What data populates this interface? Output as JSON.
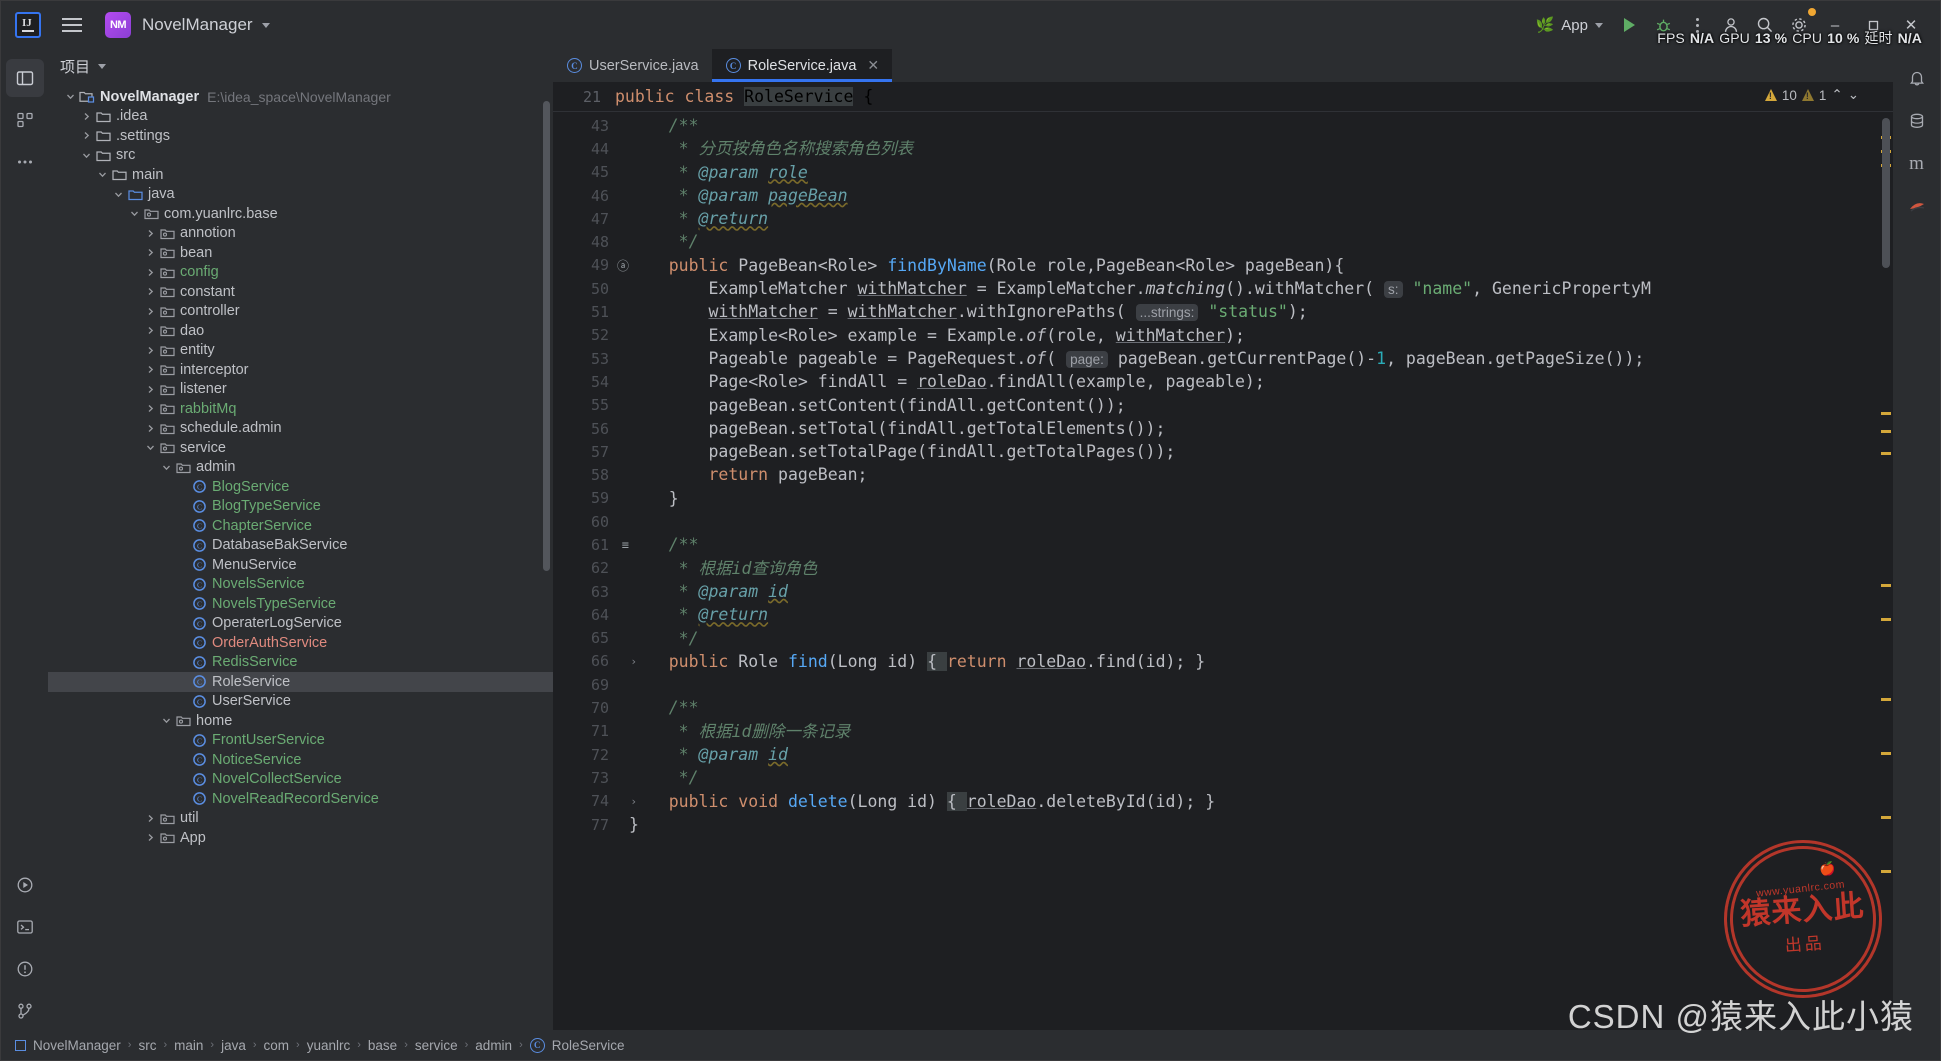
{
  "titlebar": {
    "logo_label": "IJ",
    "project_badge": "NM",
    "project_name": "NovelManager",
    "run_config": "App",
    "icons": [
      "leaf-icon",
      "run-icon",
      "debug-icon",
      "more-icon",
      "account-icon",
      "search-icon",
      "settings-icon"
    ],
    "window_controls": {
      "minimize": "–",
      "maximize": "❐",
      "close": "✕"
    },
    "perf": {
      "fps_label": "FPS",
      "fps_value": "N/A",
      "gpu_label": "GPU",
      "gpu_value": "13 %",
      "cpu_label": "CPU",
      "cpu_value": "10 %",
      "lat_label": "延时",
      "lat_value": "N/A"
    }
  },
  "left_rail": [
    {
      "name": "project-tool-icon",
      "glyph": "▣"
    },
    {
      "name": "structure-tool-icon",
      "glyph": "⌸"
    },
    {
      "name": "more-tools-icon",
      "glyph": "⋯"
    },
    {
      "name": "run-tool-icon",
      "glyph": "▷"
    },
    {
      "name": "terminal-tool-icon",
      "glyph": "⌨"
    },
    {
      "name": "problems-tool-icon",
      "glyph": "ⓘ"
    },
    {
      "name": "vcs-tool-icon",
      "glyph": "⎇"
    }
  ],
  "right_rail": [
    {
      "name": "notifications-icon",
      "glyph": "ὑ4"
    },
    {
      "name": "database-icon",
      "glyph": "⌸"
    },
    {
      "name": "maven-icon",
      "glyph": "m"
    },
    {
      "name": "ai-assistant-icon",
      "glyph": "◕"
    }
  ],
  "project_panel": {
    "header": "项目",
    "tree": [
      {
        "depth": 0,
        "twist": "v",
        "icon": "module-icon",
        "label": "NovelManager",
        "path": "E:\\idea_space\\NovelManager",
        "style": "bold"
      },
      {
        "depth": 1,
        "twist": ">",
        "icon": "folder-icon",
        "label": ".idea",
        "style": "white"
      },
      {
        "depth": 1,
        "twist": ">",
        "icon": "folder-icon",
        "label": ".settings",
        "style": "white"
      },
      {
        "depth": 1,
        "twist": "v",
        "icon": "folder-icon",
        "label": "src",
        "style": "white"
      },
      {
        "depth": 2,
        "twist": "v",
        "icon": "folder-icon",
        "label": "main",
        "style": "white"
      },
      {
        "depth": 3,
        "twist": "v",
        "icon": "source-root-icon",
        "label": "java",
        "style": "white"
      },
      {
        "depth": 4,
        "twist": "v",
        "icon": "package-icon",
        "label": "com.yuanlrc.base",
        "style": "white"
      },
      {
        "depth": 5,
        "twist": ">",
        "icon": "package-icon",
        "label": "annotion",
        "style": "white"
      },
      {
        "depth": 5,
        "twist": ">",
        "icon": "package-icon",
        "label": "bean",
        "style": "white"
      },
      {
        "depth": 5,
        "twist": ">",
        "icon": "package-icon",
        "label": "config",
        "style": "green"
      },
      {
        "depth": 5,
        "twist": ">",
        "icon": "package-icon",
        "label": "constant",
        "style": "white"
      },
      {
        "depth": 5,
        "twist": ">",
        "icon": "package-icon",
        "label": "controller",
        "style": "white"
      },
      {
        "depth": 5,
        "twist": ">",
        "icon": "package-icon",
        "label": "dao",
        "style": "white"
      },
      {
        "depth": 5,
        "twist": ">",
        "icon": "package-icon",
        "label": "entity",
        "style": "white"
      },
      {
        "depth": 5,
        "twist": ">",
        "icon": "package-icon",
        "label": "interceptor",
        "style": "white"
      },
      {
        "depth": 5,
        "twist": ">",
        "icon": "package-icon",
        "label": "listener",
        "style": "white"
      },
      {
        "depth": 5,
        "twist": ">",
        "icon": "package-icon",
        "label": "rabbitMq",
        "style": "green"
      },
      {
        "depth": 5,
        "twist": ">",
        "icon": "package-icon",
        "label": "schedule.admin",
        "style": "white"
      },
      {
        "depth": 5,
        "twist": "v",
        "icon": "package-icon",
        "label": "service",
        "style": "white"
      },
      {
        "depth": 6,
        "twist": "v",
        "icon": "package-icon",
        "label": "admin",
        "style": "white"
      },
      {
        "depth": 7,
        "twist": "",
        "icon": "class-icon",
        "label": "BlogService",
        "style": "green"
      },
      {
        "depth": 7,
        "twist": "",
        "icon": "class-icon",
        "label": "BlogTypeService",
        "style": "green"
      },
      {
        "depth": 7,
        "twist": "",
        "icon": "class-icon",
        "label": "ChapterService",
        "style": "green"
      },
      {
        "depth": 7,
        "twist": "",
        "icon": "class-icon",
        "label": "DatabaseBakService",
        "style": "white"
      },
      {
        "depth": 7,
        "twist": "",
        "icon": "class-icon",
        "label": "MenuService",
        "style": "white"
      },
      {
        "depth": 7,
        "twist": "",
        "icon": "class-icon",
        "label": "NovelsService",
        "style": "green"
      },
      {
        "depth": 7,
        "twist": "",
        "icon": "class-icon",
        "label": "NovelsTypeService",
        "style": "green"
      },
      {
        "depth": 7,
        "twist": "",
        "icon": "class-icon",
        "label": "OperaterLogService",
        "style": "white"
      },
      {
        "depth": 7,
        "twist": "",
        "icon": "class-icon",
        "label": "OrderAuthService",
        "style": "red"
      },
      {
        "depth": 7,
        "twist": "",
        "icon": "class-icon",
        "label": "RedisService",
        "style": "green"
      },
      {
        "depth": 7,
        "twist": "",
        "icon": "class-icon",
        "label": "RoleService",
        "style": "white",
        "selected": true
      },
      {
        "depth": 7,
        "twist": "",
        "icon": "class-icon",
        "label": "UserService",
        "style": "white"
      },
      {
        "depth": 6,
        "twist": "v",
        "icon": "package-icon",
        "label": "home",
        "style": "white"
      },
      {
        "depth": 7,
        "twist": "",
        "icon": "class-icon",
        "label": "FrontUserService",
        "style": "green"
      },
      {
        "depth": 7,
        "twist": "",
        "icon": "class-icon",
        "label": "NoticeService",
        "style": "green"
      },
      {
        "depth": 7,
        "twist": "",
        "icon": "class-icon",
        "label": "NovelCollectService",
        "style": "green"
      },
      {
        "depth": 7,
        "twist": "",
        "icon": "class-icon",
        "label": "NovelReadRecordService",
        "style": "green"
      },
      {
        "depth": 5,
        "twist": ">",
        "icon": "package-icon",
        "label": "util",
        "style": "white"
      },
      {
        "depth": 5,
        "twist": ">",
        "icon": "package-icon",
        "label": "App",
        "style": "white"
      }
    ]
  },
  "editor": {
    "tabs": [
      {
        "label": "UserService.java",
        "active": false,
        "closable": false
      },
      {
        "label": "RoleService.java",
        "active": true,
        "closable": true,
        "close_glyph": "✕"
      }
    ],
    "sticky_line_number": "21",
    "sticky_segments": [
      {
        "t": "public class ",
        "c": "kw"
      },
      {
        "t": "RoleService",
        "c": "hl-ident"
      },
      {
        "t": " {",
        "c": ""
      }
    ],
    "inspections": {
      "warnings_major": "10",
      "warnings_minor": "1",
      "up_glyph": "⌃",
      "down_glyph": "⌄"
    },
    "lines": [
      {
        "n": "43",
        "mark": "",
        "fold": "",
        "segs": [
          {
            "t": "    ",
            "c": ""
          },
          {
            "t": "/**",
            "c": "cm"
          }
        ]
      },
      {
        "n": "44",
        "mark": "",
        "fold": "",
        "segs": [
          {
            "t": "     ",
            "c": ""
          },
          {
            "t": "* 分页按角色名称搜索角色列表",
            "c": "cm"
          }
        ]
      },
      {
        "n": "45",
        "mark": "",
        "fold": "",
        "segs": [
          {
            "t": "     ",
            "c": ""
          },
          {
            "t": "* ",
            "c": "cm"
          },
          {
            "t": "@param",
            "c": "tag2"
          },
          {
            "t": " ",
            "c": ""
          },
          {
            "t": "role",
            "c": "tag"
          }
        ]
      },
      {
        "n": "46",
        "mark": "",
        "fold": "",
        "segs": [
          {
            "t": "     ",
            "c": ""
          },
          {
            "t": "* ",
            "c": "cm"
          },
          {
            "t": "@param",
            "c": "tag2"
          },
          {
            "t": " ",
            "c": ""
          },
          {
            "t": "pageBean",
            "c": "tag"
          }
        ]
      },
      {
        "n": "47",
        "mark": "",
        "fold": "",
        "segs": [
          {
            "t": "     ",
            "c": ""
          },
          {
            "t": "* ",
            "c": "cm"
          },
          {
            "t": "@return",
            "c": "tag"
          }
        ]
      },
      {
        "n": "48",
        "mark": "",
        "fold": "",
        "segs": [
          {
            "t": "     ",
            "c": ""
          },
          {
            "t": "*/",
            "c": "cm"
          }
        ]
      },
      {
        "n": "49",
        "mark": "@",
        "fold": "",
        "segs": [
          {
            "t": "    ",
            "c": ""
          },
          {
            "t": "public ",
            "c": "kw"
          },
          {
            "t": "PageBean<Role> ",
            "c": ""
          },
          {
            "t": "findByName",
            "c": "fn"
          },
          {
            "t": "(Role role,PageBean<Role> pageBean){",
            "c": ""
          }
        ]
      },
      {
        "n": "50",
        "mark": "",
        "fold": "",
        "segs": [
          {
            "t": "        ExampleMatcher ",
            "c": ""
          },
          {
            "t": "withMatcher",
            "c": "fld"
          },
          {
            "t": " = ExampleMatcher.",
            "c": ""
          },
          {
            "t": "matching",
            "c": "ital"
          },
          {
            "t": "().withMatcher( ",
            "c": ""
          },
          {
            "t": "s:",
            "c": "hint"
          },
          {
            "t": " ",
            "c": ""
          },
          {
            "t": "\"name\"",
            "c": "str"
          },
          {
            "t": ", GenericPropertyM",
            "c": ""
          }
        ]
      },
      {
        "n": "51",
        "mark": "",
        "fold": "",
        "segs": [
          {
            "t": "        ",
            "c": ""
          },
          {
            "t": "withMatcher",
            "c": "fld"
          },
          {
            "t": " = ",
            "c": ""
          },
          {
            "t": "withMatcher",
            "c": "fld"
          },
          {
            "t": ".withIgnorePaths( ",
            "c": ""
          },
          {
            "t": "...strings:",
            "c": "hint"
          },
          {
            "t": " ",
            "c": ""
          },
          {
            "t": "\"status\"",
            "c": "str"
          },
          {
            "t": ");",
            "c": ""
          }
        ]
      },
      {
        "n": "52",
        "mark": "",
        "fold": "",
        "segs": [
          {
            "t": "        Example<Role> example = Example.",
            "c": ""
          },
          {
            "t": "of",
            "c": "ital"
          },
          {
            "t": "(role, ",
            "c": ""
          },
          {
            "t": "withMatcher",
            "c": "fld"
          },
          {
            "t": ");",
            "c": ""
          }
        ]
      },
      {
        "n": "53",
        "mark": "",
        "fold": "",
        "segs": [
          {
            "t": "        Pageable pageable = PageRequest.",
            "c": ""
          },
          {
            "t": "of",
            "c": "ital"
          },
          {
            "t": "( ",
            "c": ""
          },
          {
            "t": "page:",
            "c": "hint"
          },
          {
            "t": " pageBean.getCurrentPage()-",
            "c": ""
          },
          {
            "t": "1",
            "c": "num"
          },
          {
            "t": ", pageBean.getPageSize());",
            "c": ""
          }
        ]
      },
      {
        "n": "54",
        "mark": "",
        "fold": "",
        "segs": [
          {
            "t": "        Page<Role> findAll = ",
            "c": ""
          },
          {
            "t": "roleDao",
            "c": "fld"
          },
          {
            "t": ".findAll(example, pageable);",
            "c": ""
          }
        ]
      },
      {
        "n": "55",
        "mark": "",
        "fold": "",
        "segs": [
          {
            "t": "        pageBean.setContent(findAll.getContent());",
            "c": ""
          }
        ]
      },
      {
        "n": "56",
        "mark": "",
        "fold": "",
        "segs": [
          {
            "t": "        pageBean.setTotal(findAll.getTotalElements());",
            "c": ""
          }
        ]
      },
      {
        "n": "57",
        "mark": "",
        "fold": "",
        "segs": [
          {
            "t": "        pageBean.setTotalPage(findAll.getTotalPages());",
            "c": ""
          }
        ]
      },
      {
        "n": "58",
        "mark": "",
        "fold": "",
        "segs": [
          {
            "t": "        ",
            "c": ""
          },
          {
            "t": "return",
            "c": "kw"
          },
          {
            "t": " pageBean;",
            "c": ""
          }
        ]
      },
      {
        "n": "59",
        "mark": "",
        "fold": "",
        "segs": [
          {
            "t": "    }",
            "c": ""
          }
        ]
      },
      {
        "n": "60",
        "mark": "",
        "fold": "",
        "segs": [
          {
            "t": "",
            "c": ""
          }
        ]
      },
      {
        "n": "61",
        "mark": "≡",
        "fold": "",
        "segs": [
          {
            "t": "    ",
            "c": ""
          },
          {
            "t": "/**",
            "c": "cm"
          }
        ]
      },
      {
        "n": "62",
        "mark": "",
        "fold": "",
        "segs": [
          {
            "t": "     ",
            "c": ""
          },
          {
            "t": "* 根据id查询角色",
            "c": "cm"
          }
        ]
      },
      {
        "n": "63",
        "mark": "",
        "fold": "",
        "segs": [
          {
            "t": "     ",
            "c": ""
          },
          {
            "t": "* ",
            "c": "cm"
          },
          {
            "t": "@param",
            "c": "tag2"
          },
          {
            "t": " ",
            "c": ""
          },
          {
            "t": "id",
            "c": "tag"
          }
        ]
      },
      {
        "n": "64",
        "mark": "",
        "fold": "",
        "segs": [
          {
            "t": "     ",
            "c": ""
          },
          {
            "t": "* ",
            "c": "cm"
          },
          {
            "t": "@return",
            "c": "tag"
          }
        ]
      },
      {
        "n": "65",
        "mark": "",
        "fold": "",
        "segs": [
          {
            "t": "     ",
            "c": ""
          },
          {
            "t": "*/",
            "c": "cm"
          }
        ]
      },
      {
        "n": "66",
        "mark": "",
        "fold": ">",
        "segs": [
          {
            "t": "    ",
            "c": ""
          },
          {
            "t": "public ",
            "c": "kw"
          },
          {
            "t": "Role ",
            "c": ""
          },
          {
            "t": "find",
            "c": "fn"
          },
          {
            "t": "(Long id) ",
            "c": ""
          },
          {
            "t": "{ ",
            "c": "hl-ident"
          },
          {
            "t": "return",
            "c": "kw"
          },
          {
            "t": " ",
            "c": ""
          },
          {
            "t": "roleDao",
            "c": "fld"
          },
          {
            "t": ".find(id); }",
            "c": ""
          }
        ]
      },
      {
        "n": "69",
        "mark": "",
        "fold": "",
        "segs": [
          {
            "t": "",
            "c": ""
          }
        ]
      },
      {
        "n": "70",
        "mark": "",
        "fold": "",
        "segs": [
          {
            "t": "    ",
            "c": ""
          },
          {
            "t": "/**",
            "c": "cm"
          }
        ]
      },
      {
        "n": "71",
        "mark": "",
        "fold": "",
        "segs": [
          {
            "t": "     ",
            "c": ""
          },
          {
            "t": "* 根据id删除一条记录",
            "c": "cm"
          }
        ]
      },
      {
        "n": "72",
        "mark": "",
        "fold": "",
        "segs": [
          {
            "t": "     ",
            "c": ""
          },
          {
            "t": "* ",
            "c": "cm"
          },
          {
            "t": "@param",
            "c": "tag2"
          },
          {
            "t": " ",
            "c": ""
          },
          {
            "t": "id",
            "c": "tag"
          }
        ]
      },
      {
        "n": "73",
        "mark": "",
        "fold": "",
        "segs": [
          {
            "t": "     ",
            "c": ""
          },
          {
            "t": "*/",
            "c": "cm"
          }
        ]
      },
      {
        "n": "74",
        "mark": "",
        "fold": ">",
        "segs": [
          {
            "t": "    ",
            "c": ""
          },
          {
            "t": "public void ",
            "c": "kw"
          },
          {
            "t": "delete",
            "c": "fn"
          },
          {
            "t": "(Long id) ",
            "c": ""
          },
          {
            "t": "{ ",
            "c": "hl-ident"
          },
          {
            "t": "roleDao",
            "c": "fld"
          },
          {
            "t": ".deleteById(id); }",
            "c": ""
          }
        ]
      },
      {
        "n": "77",
        "mark": "",
        "fold": "",
        "segs": [
          {
            "t": "}",
            "c": ""
          }
        ]
      }
    ]
  },
  "status_bar": {
    "breadcrumb": [
      "NovelManager",
      "src",
      "main",
      "java",
      "com",
      "yuanlrc",
      "base",
      "service",
      "admin",
      "RoleService"
    ],
    "separator": "›"
  },
  "watermarks": {
    "stamp_domain": "www.yuanlrc.com",
    "stamp_main": "猿来入此",
    "stamp_sub": "出品",
    "csdn_text": "CSDN @猿来入此小猿"
  },
  "colors": {
    "accent": "#3574f0",
    "green": "#6aab73",
    "red": "#e08a7f",
    "keyword": "#cf8e6d",
    "comment": "#5f826b",
    "bg_editor": "#1e1f22",
    "bg_panel": "#2b2d30"
  }
}
